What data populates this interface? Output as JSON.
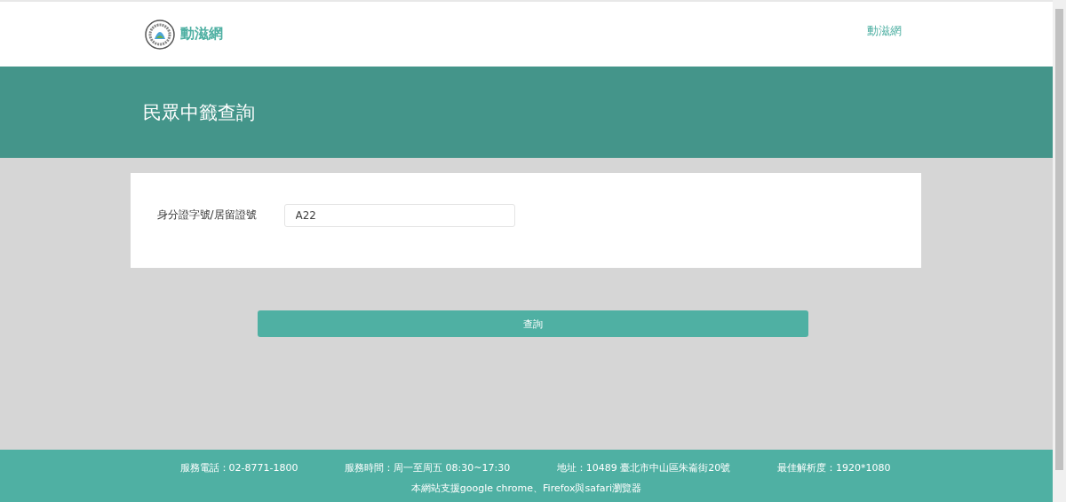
{
  "header": {
    "site_name": "動滋網",
    "nav_link": "動滋網"
  },
  "banner": {
    "title": "民眾中籤查詢"
  },
  "form": {
    "label": "身分證字號/居留證號",
    "value": "A22"
  },
  "submit_button": "查詢",
  "footer": {
    "info": [
      "服務電話：02-8771-1800",
      "服務時間：周一至周五 08:30~17:30",
      "地址：10489 臺北市中山區朱崙街20號",
      "最佳解析度：1920*1080"
    ],
    "browser_note": "本網站支援google chrome、Firefox與safari瀏覽器"
  }
}
